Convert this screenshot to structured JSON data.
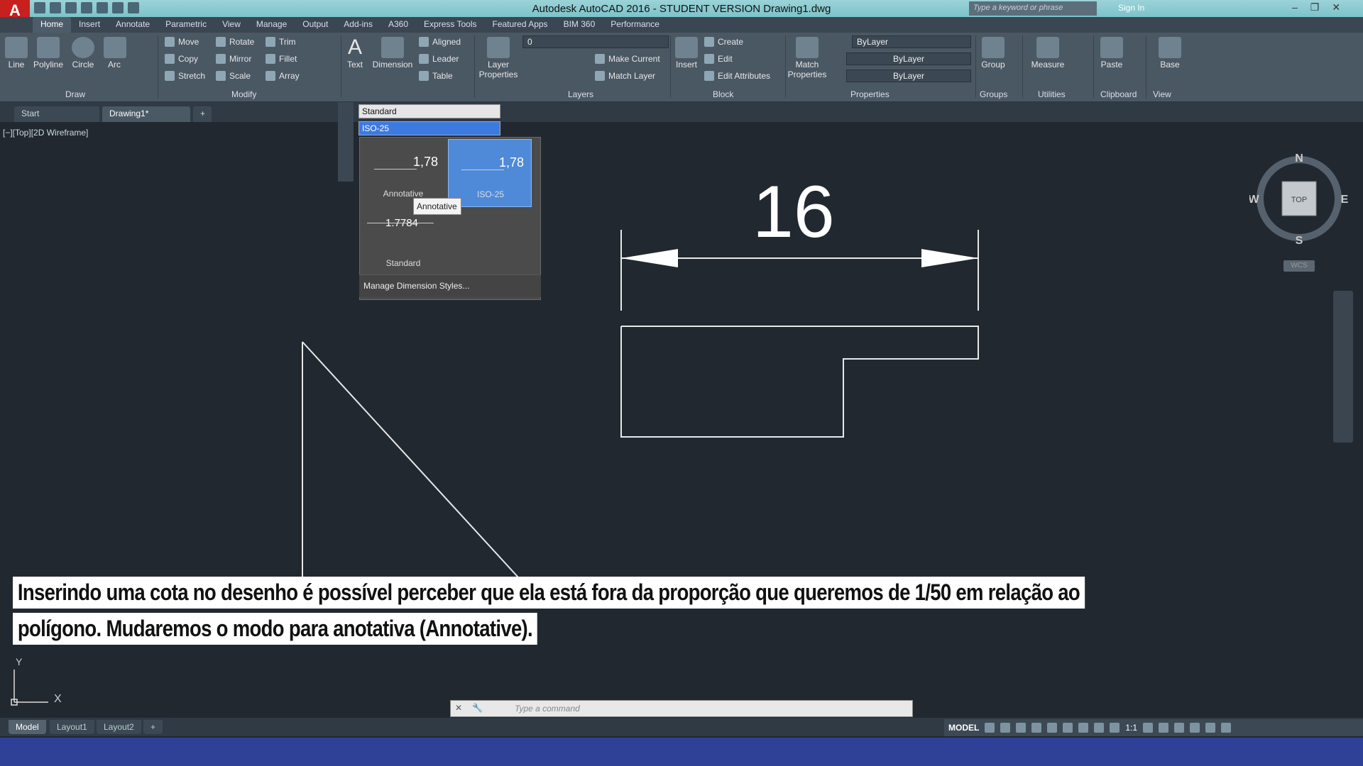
{
  "app": {
    "logo": "A",
    "title": "Autodesk AutoCAD 2016 - STUDENT VERSION    Drawing1.dwg",
    "search_placeholder": "Type a keyword or phrase",
    "sign_in": "Sign In"
  },
  "tabs": [
    "Home",
    "Insert",
    "Annotate",
    "Parametric",
    "View",
    "Manage",
    "Output",
    "Add-ins",
    "A360",
    "Express Tools",
    "Featured Apps",
    "BIM 360",
    "Performance"
  ],
  "ribbon": {
    "draw": {
      "line": "Line",
      "polyline": "Polyline",
      "circle": "Circle",
      "arc": "Arc",
      "label": "Draw"
    },
    "modify": {
      "move": "Move",
      "rotate": "Rotate",
      "trim": "Trim",
      "copy": "Copy",
      "mirror": "Mirror",
      "fillet": "Fillet",
      "stretch": "Stretch",
      "scale": "Scale",
      "array": "Array",
      "label": "Modify"
    },
    "annotation": {
      "text": "Text",
      "dimension": "Dimension",
      "aligned": "Aligned",
      "leader": "Leader",
      "table": "Table"
    },
    "layers": {
      "layer_properties": "Layer Properties",
      "layer_value": "0",
      "make_current": "Make Current",
      "match_layer": "Match Layer",
      "label": "Layers"
    },
    "block": {
      "insert": "Insert",
      "create": "Create",
      "edit": "Edit",
      "edit_attributes": "Edit Attributes",
      "label": "Block"
    },
    "properties": {
      "match": "Match Properties",
      "color": "ByLayer",
      "linetype": "ByLayer",
      "lineweight": "ByLayer",
      "label": "Properties"
    },
    "groups": {
      "group": "Group",
      "label": "Groups"
    },
    "utilities": {
      "measure": "Measure",
      "label": "Utilities"
    },
    "clipboard": {
      "paste": "Paste",
      "label": "Clipboard"
    },
    "view": {
      "base": "Base",
      "label": "View"
    }
  },
  "filetabs": {
    "start": "Start",
    "drawing": "Drawing1*",
    "add": "+"
  },
  "viewport_label": "[−][Top][2D Wireframe]",
  "dim_style": {
    "text_style": "Standard",
    "current": "ISO-25",
    "tiles": [
      {
        "value": "1,78",
        "name": "Annotative"
      },
      {
        "value": "1,78",
        "name": "ISO-25"
      },
      {
        "value": "1.7784",
        "name": "Standard"
      }
    ],
    "tooltip": "Annotative",
    "manage": "Manage Dimension Styles..."
  },
  "dimension_value": "16",
  "navcube": {
    "n": "N",
    "s": "S",
    "e": "E",
    "w": "W",
    "top": "TOP",
    "wcs": "WCS"
  },
  "ucs": {
    "x": "X",
    "y": "Y"
  },
  "caption": {
    "line1": "Inserindo uma cota no desenho é possível perceber que ela está fora da proporção que queremos de 1/50 em relação ao",
    "line2": "polígono. Mudaremos o modo para anotativa (Annotative)."
  },
  "command_placeholder": "Type a command",
  "layout_tabs": [
    "Model",
    "Layout1",
    "Layout2",
    "+"
  ],
  "status": {
    "model": "MODEL",
    "scale": "1:1"
  }
}
